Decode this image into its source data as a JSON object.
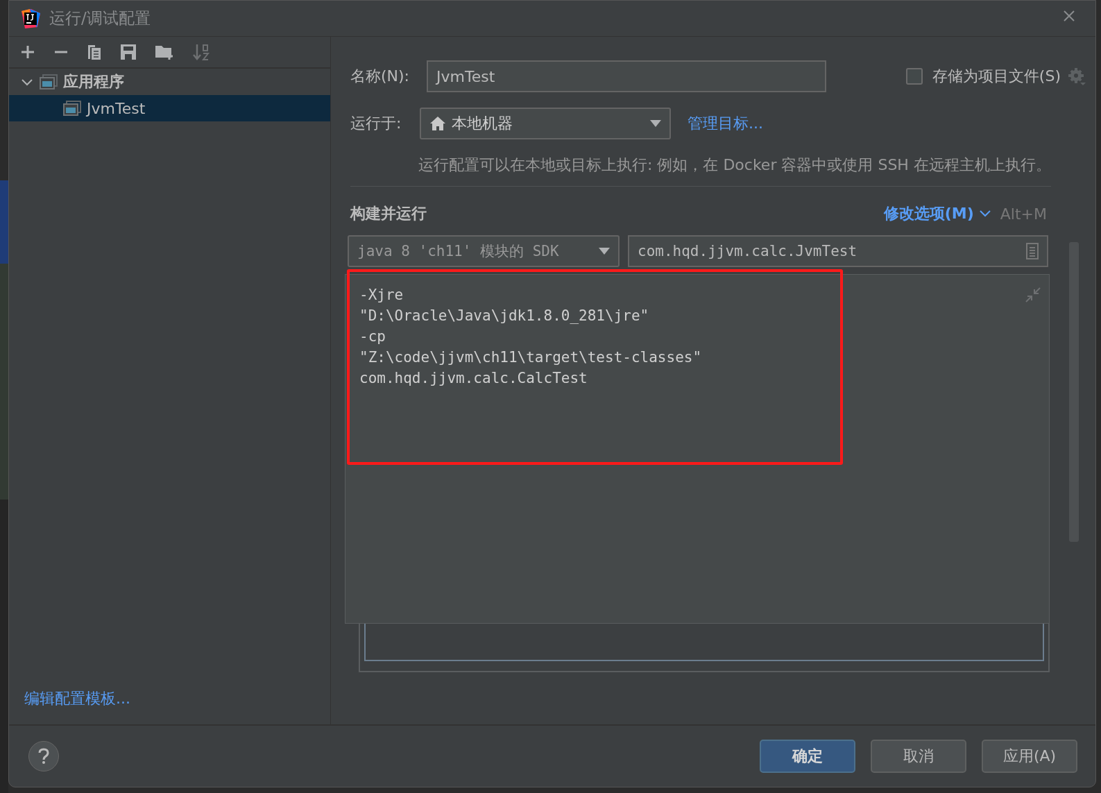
{
  "window": {
    "title": "运行/调试配置"
  },
  "tree": [
    {
      "label": "应用程序",
      "expanded": true,
      "selected": false,
      "children": [
        {
          "label": "JvmTest",
          "selected": true
        }
      ]
    }
  ],
  "edit_templates_link": "编辑配置模板...",
  "name_row": {
    "label": "名称(N):",
    "value": "JvmTest",
    "store_checkbox": {
      "label": "存储为项目文件(S)",
      "checked": false
    }
  },
  "run_on": {
    "label": "运行于:",
    "value": "本地机器",
    "manage_link": "管理目标...",
    "description": "运行配置可以在本地或目标上执行: 例如，在 Docker 容器中或使用 SSH 在远程主机上执行。"
  },
  "build_and_run": {
    "title": "构建并运行",
    "modify_options_link": "修改选项(M)",
    "shortcut": "Alt+M",
    "sdk_dropdown": "java 8 'ch11' 模块的 SDK",
    "main_class": "com.hqd.jjvm.calc.JvmTest",
    "vm_options": "-Xjre\n\"D:\\Oracle\\Java\\jdk1.8.0_281\\jre\"\n-cp\n\"Z:\\code\\jjvm\\ch11\\target\\test-classes\"\ncom.hqd.jjvm.calc.CalcTest"
  },
  "buttons": [
    {
      "label": "确定",
      "kind": "primary"
    },
    {
      "label": "取消",
      "kind": "secondary"
    },
    {
      "label": "应用(A)",
      "kind": "secondary"
    }
  ]
}
